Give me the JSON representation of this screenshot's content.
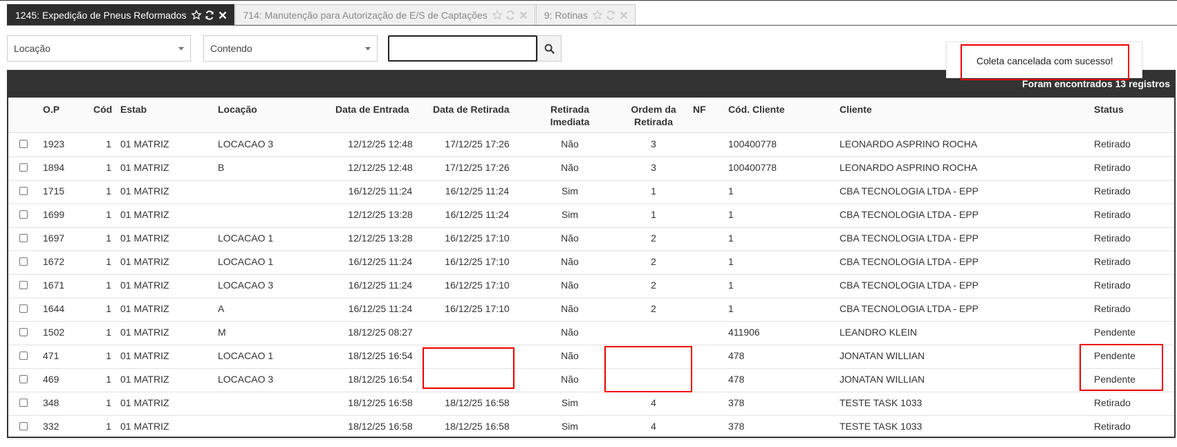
{
  "tabs": [
    {
      "label": "1245: Expedição de Pneus Reformados",
      "active": true
    },
    {
      "label": "714: Manutenção para Autorização de E/S de Captações",
      "active": false
    },
    {
      "label": "9: Rotinas",
      "active": false
    }
  ],
  "filters": {
    "field_select": "Locação",
    "operator_select": "Contendo",
    "search_value": ""
  },
  "toast": {
    "message": "Coleta cancelada com sucesso!"
  },
  "grid": {
    "records_text": "Foram encontrados 13 registros",
    "headers": {
      "op": "O.P",
      "cod": "Cód",
      "estab": "Estab",
      "locacao": "Locação",
      "data_entrada": "Data de Entrada",
      "data_retirada": "Data de Retirada",
      "retirada_imediata_1": "Retirada",
      "retirada_imediata_2": "Imediata",
      "ordem_retirada_1": "Ordem da",
      "ordem_retirada_2": "Retirada",
      "nf": "NF",
      "cod_cliente": "Cód. Cliente",
      "cliente": "Cliente",
      "status": "Status"
    },
    "rows": [
      {
        "op": "1923",
        "cod": "1",
        "estab": "01 MATRIZ",
        "locacao": "LOCACAO 3",
        "entrada": "12/12/25 12:48",
        "retirada": "17/12/25 17:26",
        "imediata": "Não",
        "ordem": "3",
        "nf": "",
        "cod_cliente": "100400778",
        "cliente": "LEONARDO ASPRINO ROCHA",
        "status": "Retirado"
      },
      {
        "op": "1894",
        "cod": "1",
        "estab": "01 MATRIZ",
        "locacao": "B",
        "entrada": "12/12/25 12:48",
        "retirada": "17/12/25 17:26",
        "imediata": "Não",
        "ordem": "3",
        "nf": "",
        "cod_cliente": "100400778",
        "cliente": "LEONARDO ASPRINO ROCHA",
        "status": "Retirado"
      },
      {
        "op": "1715",
        "cod": "1",
        "estab": "01 MATRIZ",
        "locacao": "",
        "entrada": "16/12/25 11:24",
        "retirada": "16/12/25 11:24",
        "imediata": "Sim",
        "ordem": "1",
        "nf": "",
        "cod_cliente": "1",
        "cliente": "CBA TECNOLOGIA LTDA - EPP",
        "status": "Retirado"
      },
      {
        "op": "1699",
        "cod": "1",
        "estab": "01 MATRIZ",
        "locacao": "",
        "entrada": "12/12/25 13:28",
        "retirada": "16/12/25 11:24",
        "imediata": "Sim",
        "ordem": "1",
        "nf": "",
        "cod_cliente": "1",
        "cliente": "CBA TECNOLOGIA LTDA - EPP",
        "status": "Retirado"
      },
      {
        "op": "1697",
        "cod": "1",
        "estab": "01 MATRIZ",
        "locacao": "LOCACAO 1",
        "entrada": "12/12/25 13:28",
        "retirada": "16/12/25 17:10",
        "imediata": "Não",
        "ordem": "2",
        "nf": "",
        "cod_cliente": "1",
        "cliente": "CBA TECNOLOGIA LTDA - EPP",
        "status": "Retirado"
      },
      {
        "op": "1672",
        "cod": "1",
        "estab": "01 MATRIZ",
        "locacao": "LOCACAO 1",
        "entrada": "16/12/25 11:24",
        "retirada": "16/12/25 17:10",
        "imediata": "Não",
        "ordem": "2",
        "nf": "",
        "cod_cliente": "1",
        "cliente": "CBA TECNOLOGIA LTDA - EPP",
        "status": "Retirado"
      },
      {
        "op": "1671",
        "cod": "1",
        "estab": "01 MATRIZ",
        "locacao": "LOCACAO 3",
        "entrada": "16/12/25 11:24",
        "retirada": "16/12/25 17:10",
        "imediata": "Não",
        "ordem": "2",
        "nf": "",
        "cod_cliente": "1",
        "cliente": "CBA TECNOLOGIA LTDA - EPP",
        "status": "Retirado"
      },
      {
        "op": "1644",
        "cod": "1",
        "estab": "01 MATRIZ",
        "locacao": "A",
        "entrada": "16/12/25 11:24",
        "retirada": "16/12/25 17:10",
        "imediata": "Não",
        "ordem": "2",
        "nf": "",
        "cod_cliente": "1",
        "cliente": "CBA TECNOLOGIA LTDA - EPP",
        "status": "Retirado"
      },
      {
        "op": "1502",
        "cod": "1",
        "estab": "01 MATRIZ",
        "locacao": "M",
        "entrada": "18/12/25 08:27",
        "retirada": "",
        "imediata": "Não",
        "ordem": "",
        "nf": "",
        "cod_cliente": "411906",
        "cliente": "LEANDRO KLEIN",
        "status": "Pendente"
      },
      {
        "op": "471",
        "cod": "1",
        "estab": "01 MATRIZ",
        "locacao": "LOCACAO 1",
        "entrada": "18/12/25 16:54",
        "retirada": "",
        "imediata": "Não",
        "ordem": "",
        "nf": "",
        "cod_cliente": "478",
        "cliente": "JONATAN WILLIAN",
        "status": "Pendente"
      },
      {
        "op": "469",
        "cod": "1",
        "estab": "01 MATRIZ",
        "locacao": "LOCACAO 3",
        "entrada": "18/12/25 16:54",
        "retirada": "",
        "imediata": "Não",
        "ordem": "",
        "nf": "",
        "cod_cliente": "478",
        "cliente": "JONATAN WILLIAN",
        "status": "Pendente"
      },
      {
        "op": "348",
        "cod": "1",
        "estab": "01 MATRIZ",
        "locacao": "",
        "entrada": "18/12/25 16:58",
        "retirada": "18/12/25 16:58",
        "imediata": "Sim",
        "ordem": "4",
        "nf": "",
        "cod_cliente": "378",
        "cliente": "TESTE TASK 1033",
        "status": "Retirado"
      },
      {
        "op": "332",
        "cod": "1",
        "estab": "01 MATRIZ",
        "locacao": "",
        "entrada": "18/12/25 16:58",
        "retirada": "18/12/25 16:58",
        "imediata": "Sim",
        "ordem": "4",
        "nf": "",
        "cod_cliente": "378",
        "cliente": "TESTE TASK 1033",
        "status": "Retirado"
      }
    ]
  },
  "colors": {
    "dark_bar": "#333333",
    "annotation_red": "#e00000"
  }
}
